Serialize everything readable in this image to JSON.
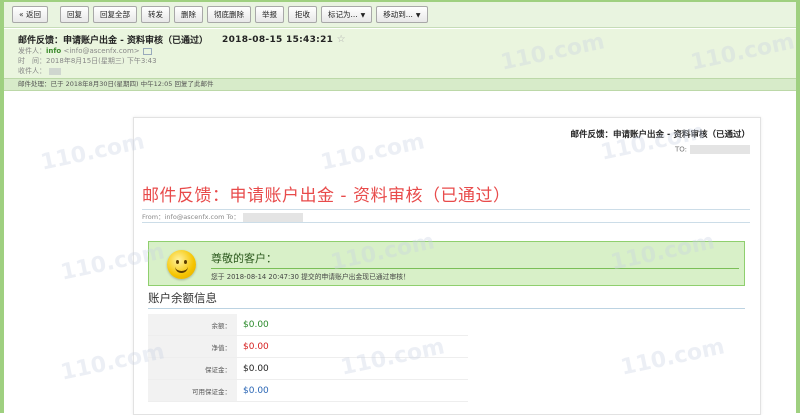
{
  "toolbar": {
    "buttons": [
      "« 返回",
      "回复",
      "回复全部",
      "转发",
      "删除",
      "彻底删除",
      "举报",
      "拒收",
      "标记为...",
      "移动到..."
    ]
  },
  "header": {
    "subject": "邮件反馈：申请账户出金 - 资料审核（已通过）",
    "datetime": "2018-08-15 15:43:21",
    "star": "☆",
    "sender_label": "发件人：",
    "sender_name": "info",
    "sender_addr": "<info@ascenfx.com>",
    "time_label": "时　间：",
    "time_value": "2018年8月15日(星期三) 下午3:43",
    "recipient_label": "收件人："
  },
  "status": {
    "text": "邮件处理：已于 2018年8月30日(星期四) 中午12:05 回复了此邮件"
  },
  "email": {
    "title_small": "邮件反馈：申请账户出金 - 资料审核（已通过）",
    "to_label": "TO:",
    "title_big": "邮件反馈：申请账户出金 - 资料审核（已通过）",
    "from_line": "From：info@ascenfx.com To：",
    "greeting": "尊敬的客户：",
    "message": "您于 2018-08-14 20:47:30 提交的申请账户出金现已通过审核！",
    "section_title": "账户余额信息",
    "balances": [
      {
        "label": "余额：",
        "value": "$0.00",
        "color": "#2a8a2a"
      },
      {
        "label": "净值：",
        "value": "$0.00",
        "color": "#d62020"
      },
      {
        "label": "保证金：",
        "value": "$0.00",
        "color": "#222222"
      },
      {
        "label": "可用保证金：",
        "value": "$0.00",
        "color": "#2a66b5"
      }
    ]
  },
  "watermark": "110.com"
}
